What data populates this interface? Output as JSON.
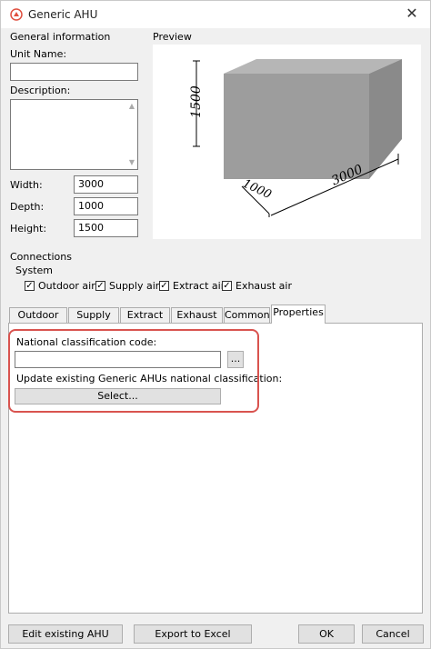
{
  "window": {
    "title": "Generic AHU"
  },
  "general_info": {
    "heading": "General information",
    "unit_name_label": "Unit Name:",
    "unit_name_value": "",
    "description_label": "Description:",
    "description_value": "",
    "width_label": "Width:",
    "width_value": "3000",
    "depth_label": "Depth:",
    "depth_value": "1000",
    "height_label": "Height:",
    "height_value": "1500"
  },
  "preview": {
    "heading": "Preview",
    "dim_height": "1500",
    "dim_depth": "1000",
    "dim_width": "3000"
  },
  "connections": {
    "heading": "Connections",
    "system_label": "System",
    "checkboxes": [
      {
        "label": "Outdoor air",
        "checked": true
      },
      {
        "label": "Supply air",
        "checked": true
      },
      {
        "label": "Extract air",
        "checked": true
      },
      {
        "label": "Exhaust air",
        "checked": true
      }
    ]
  },
  "tabs": [
    {
      "label": "Outdoor air"
    },
    {
      "label": "Supply air"
    },
    {
      "label": "Extract air"
    },
    {
      "label": "Exhaust air"
    },
    {
      "label": "Common"
    },
    {
      "label": "Properties",
      "active": true
    }
  ],
  "properties_tab": {
    "classification_label": "National classification code:",
    "classification_value": "",
    "browse_label": "...",
    "update_label": "Update existing Generic AHUs national classification:",
    "select_label": "Select..."
  },
  "footer": {
    "edit_label": "Edit existing AHU",
    "export_label": "Export to Excel",
    "ok_label": "OK",
    "cancel_label": "Cancel"
  },
  "colors": {
    "highlight": "#d9534f",
    "accent": "#e05040"
  },
  "icons": {
    "app": "ahu-app-icon",
    "close": "close-icon"
  }
}
